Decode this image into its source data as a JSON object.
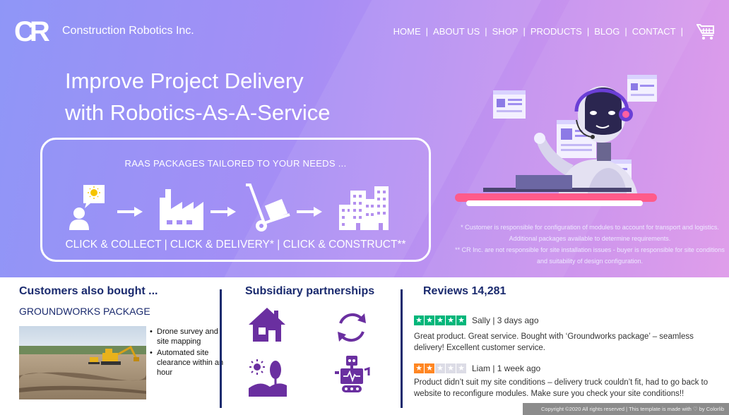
{
  "brand": {
    "logo_text": "CR",
    "company_name": "Construction Robotics Inc."
  },
  "nav": {
    "items": [
      "HOME",
      "ABOUT US",
      "SHOP",
      "PRODUCTS",
      "BLOG",
      "CONTACT"
    ],
    "separator": "|",
    "cart_icon": "cart-icon"
  },
  "hero": {
    "headline_line1": "Improve Project Delivery",
    "headline_line2": "with Robotics-As-A-Service",
    "raas_title": "RAAS PACKAGES TAILORED TO YOUR NEEDS ...",
    "raas_steps": "CLICK & COLLECT | CLICK & DELIVERY* | CLICK & CONSTRUCT**",
    "raas_icons": [
      "idea-person-icon",
      "factory-icon",
      "hand-truck-icon",
      "city-buildings-icon"
    ],
    "disclaimer_1": "* Customer is responsible for configuration of modules to account for transport and logistics. Additional packages available to determine requirements.",
    "disclaimer_2": "** CR Inc. are not responsible for site installation issues - buyer is responsible for site conditions and suitability of design configuration."
  },
  "customers": {
    "title": "Customers also bought ...",
    "package_title": "GROUNDWORKS PACKAGE",
    "bullets": [
      "Drone survey and site mapping",
      "Automated site clearance within an hour"
    ]
  },
  "subsidiary": {
    "title": "Subsidiary partnerships",
    "icons": [
      "house-icon",
      "recycle-arrows-icon",
      "sun-tree-hills-icon",
      "robot-icon"
    ]
  },
  "reviews": {
    "title": "Reviews 14,281",
    "items": [
      {
        "rating": 5,
        "author_meta": "Sally | 3 days ago",
        "text": "Great product. Great service. Bought with ‘Groundworks package’ – seamless delivery! Excellent customer service."
      },
      {
        "rating": 2,
        "author_meta": "Liam | 1 week ago",
        "text": "Product didn’t suit my site conditions – delivery truck couldn’t fit, had to go back to website to reconfigure modules. Make sure you check your site conditions!!"
      }
    ]
  },
  "footer": {
    "copyright": "Copyright ©2020 All rights reserved | This template is made with ♡ by Colorlib"
  },
  "colors": {
    "accent": "#6a2fa0",
    "navy": "#1a2a6e",
    "star_green": "#00b67a",
    "star_orange": "#ff8622",
    "star_empty": "#dcdce6"
  }
}
